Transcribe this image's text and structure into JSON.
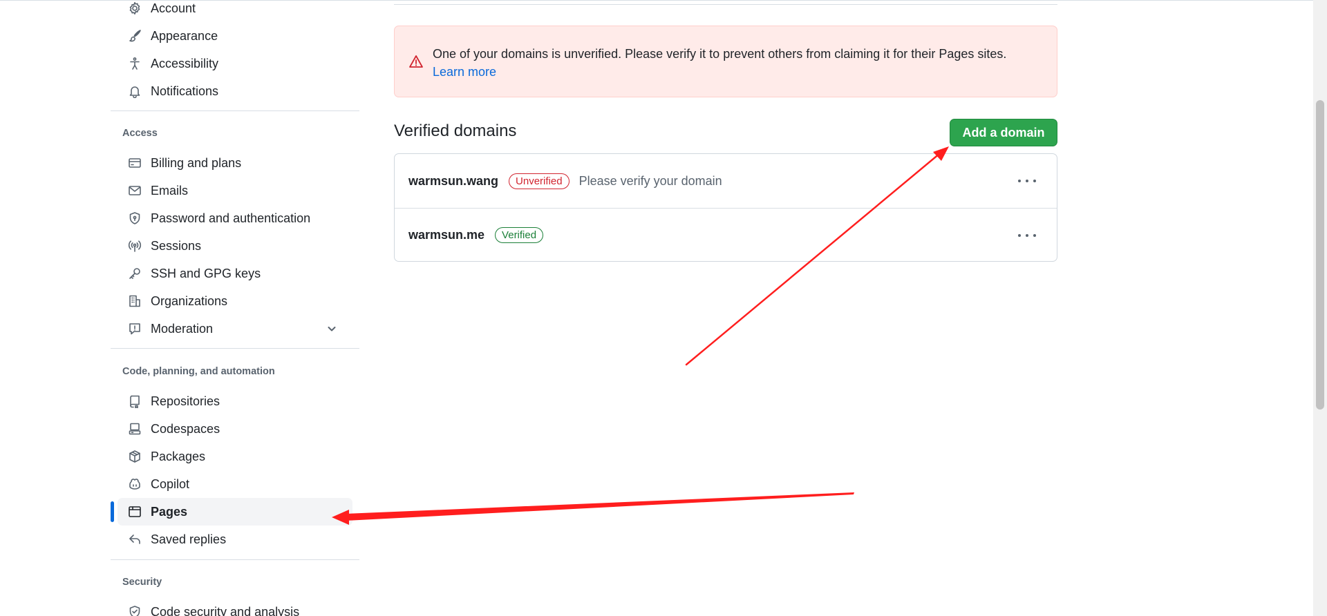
{
  "sidebar": {
    "top_items": [
      {
        "label": "Account",
        "icon": "gear-icon"
      },
      {
        "label": "Appearance",
        "icon": "paintbrush-icon"
      },
      {
        "label": "Accessibility",
        "icon": "accessibility-icon"
      },
      {
        "label": "Notifications",
        "icon": "bell-icon"
      }
    ],
    "access": {
      "heading": "Access",
      "items": [
        {
          "label": "Billing and plans",
          "icon": "credit-card-icon"
        },
        {
          "label": "Emails",
          "icon": "mail-icon"
        },
        {
          "label": "Password and authentication",
          "icon": "shield-lock-icon"
        },
        {
          "label": "Sessions",
          "icon": "broadcast-icon"
        },
        {
          "label": "SSH and GPG keys",
          "icon": "key-icon"
        },
        {
          "label": "Organizations",
          "icon": "organization-icon"
        },
        {
          "label": "Moderation",
          "icon": "report-icon"
        }
      ]
    },
    "code": {
      "heading": "Code, planning, and automation",
      "items": [
        {
          "label": "Repositories",
          "icon": "repo-icon"
        },
        {
          "label": "Codespaces",
          "icon": "codespaces-icon"
        },
        {
          "label": "Packages",
          "icon": "package-icon"
        },
        {
          "label": "Copilot",
          "icon": "copilot-icon"
        },
        {
          "label": "Pages",
          "icon": "browser-icon",
          "active": true
        },
        {
          "label": "Saved replies",
          "icon": "reply-icon"
        }
      ]
    },
    "security": {
      "heading": "Security",
      "items": [
        {
          "label": "Code security and analysis",
          "icon": "shield-check-icon"
        }
      ]
    }
  },
  "flash": {
    "message": "One of your domains is unverified. Please verify it to prevent others from claiming it for their Pages sites.",
    "link_text": "Learn more"
  },
  "main": {
    "title": "Verified domains",
    "add_button": "Add a domain",
    "domains": [
      {
        "name": "warmsun.wang",
        "status": "Unverified",
        "hint": "Please verify your domain"
      },
      {
        "name": "warmsun.me",
        "status": "Verified",
        "hint": ""
      }
    ]
  },
  "colors": {
    "accent": "#0969da",
    "primary_button": "#2da44e",
    "danger": "#d1242f",
    "success": "#1a7f37",
    "flash_bg": "#ffebe9",
    "annotation_arrow": "#ff1e1e"
  }
}
